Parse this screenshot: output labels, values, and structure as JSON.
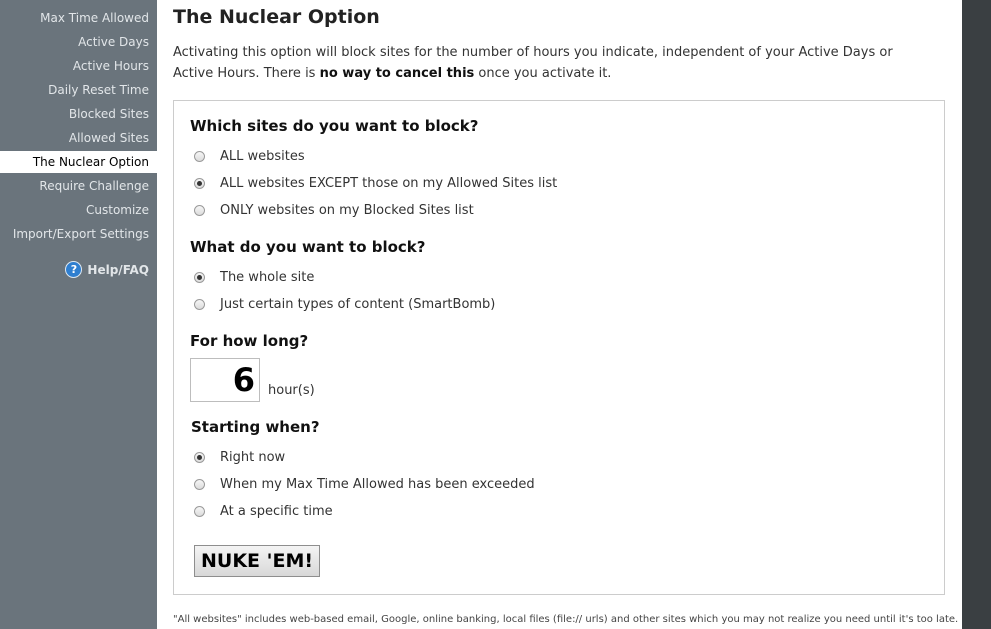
{
  "sidebar": {
    "items": [
      {
        "label": "Max Time Allowed"
      },
      {
        "label": "Active Days"
      },
      {
        "label": "Active Hours"
      },
      {
        "label": "Daily Reset Time"
      },
      {
        "label": "Blocked Sites"
      },
      {
        "label": "Allowed Sites"
      },
      {
        "label": "The Nuclear Option",
        "active": true
      },
      {
        "label": "Require Challenge"
      },
      {
        "label": "Customize"
      },
      {
        "label": "Import/Export Settings"
      }
    ],
    "help": {
      "icon": "help-icon",
      "label": "Help/FAQ"
    }
  },
  "page": {
    "title": "The Nuclear Option",
    "intro_part1": "Activating this option will block sites for the number of hours you indicate, independent of your Active Days or Active Hours. There is ",
    "intro_bold": "no way to cancel this",
    "intro_part2": " once you activate it."
  },
  "form": {
    "sites_heading": "Which sites do you want to block?",
    "sites_options": [
      {
        "label": "ALL websites",
        "checked": false
      },
      {
        "label": "ALL websites EXCEPT those on my Allowed Sites list",
        "checked": true
      },
      {
        "label": "ONLY websites on my Blocked Sites list",
        "checked": false
      }
    ],
    "what_heading": "What do you want to block?",
    "what_options": [
      {
        "label": "The whole site",
        "checked": true
      },
      {
        "label": "Just certain types of content (SmartBomb)",
        "checked": false
      }
    ],
    "duration_heading": "For how long?",
    "hours_value": "6",
    "hours_unit": "hour(s)",
    "start_heading": "Starting when?",
    "start_options": [
      {
        "label": "Right now",
        "checked": true
      },
      {
        "label": "When my Max Time Allowed has been exceeded",
        "checked": false
      },
      {
        "label": "At a specific time",
        "checked": false
      }
    ],
    "submit_label": "NUKE 'EM!"
  },
  "footnote": "\"All websites\" includes web-based email, Google, online banking, local files (file:// urls) and other sites which you may not realize you need until it's too late.",
  "colors": {
    "sidebar_bg": "#6a747c",
    "right_bar_bg": "#3a3f42",
    "help_icon": "#2f7fd0"
  }
}
